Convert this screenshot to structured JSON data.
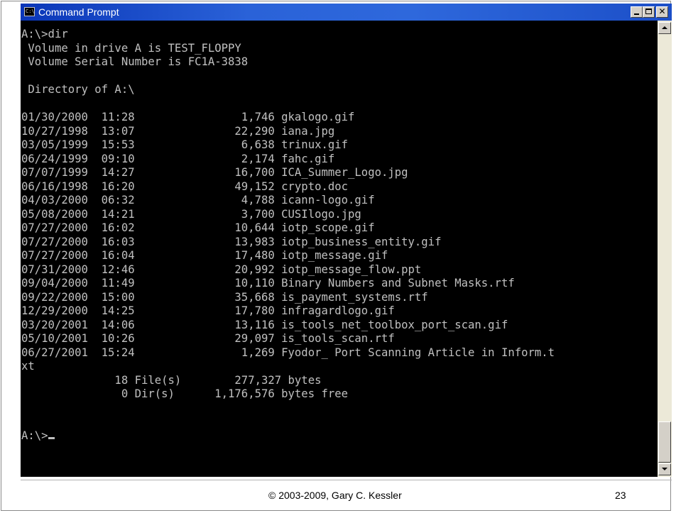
{
  "window": {
    "title": "Command Prompt",
    "icon_name": "command-prompt-icon",
    "icon_text": "C:\\"
  },
  "console": {
    "lines": [
      "",
      "A:\\>dir",
      " Volume in drive A is TEST_FLOPPY",
      " Volume Serial Number is FC1A-3838",
      "",
      " Directory of A:\\",
      "",
      "01/30/2000  11:28                1,746 gkalogo.gif",
      "10/27/1998  13:07               22,290 iana.jpg",
      "03/05/1999  15:53                6,638 trinux.gif",
      "06/24/1999  09:10                2,174 fahc.gif",
      "07/07/1999  14:27               16,700 ICA_Summer_Logo.jpg",
      "06/16/1998  16:20               49,152 crypto.doc",
      "04/03/2000  06:32                4,788 icann-logo.gif",
      "05/08/2000  14:21                3,700 CUSIlogo.jpg",
      "07/27/2000  16:02               10,644 iotp_scope.gif",
      "07/27/2000  16:03               13,983 iotp_business_entity.gif",
      "07/27/2000  16:04               17,480 iotp_message.gif",
      "07/31/2000  12:46               20,992 iotp_message_flow.ppt",
      "09/04/2000  11:49               10,110 Binary Numbers and Subnet Masks.rtf",
      "09/22/2000  15:00               35,668 is_payment_systems.rtf",
      "12/29/2000  14:25               17,780 infragardlogo.gif",
      "03/20/2001  14:06               13,116 is_tools_net_toolbox_port_scan.gif",
      "05/10/2001  10:26               29,097 is_tools_scan.rtf",
      "06/27/2001  15:24                1,269 Fyodor_ Port Scanning Article in Inform.t",
      "xt",
      "              18 File(s)        277,327 bytes",
      "               0 Dir(s)      1,176,576 bytes free",
      "",
      ""
    ],
    "prompt": "A:\\>"
  },
  "footer": {
    "copyright": "© 2003-2009, Gary C. Kessler",
    "page_number": "23"
  },
  "colors": {
    "console_bg": "#000000",
    "console_fg": "#c0c0c0",
    "titlebar": "#2a62d8"
  }
}
